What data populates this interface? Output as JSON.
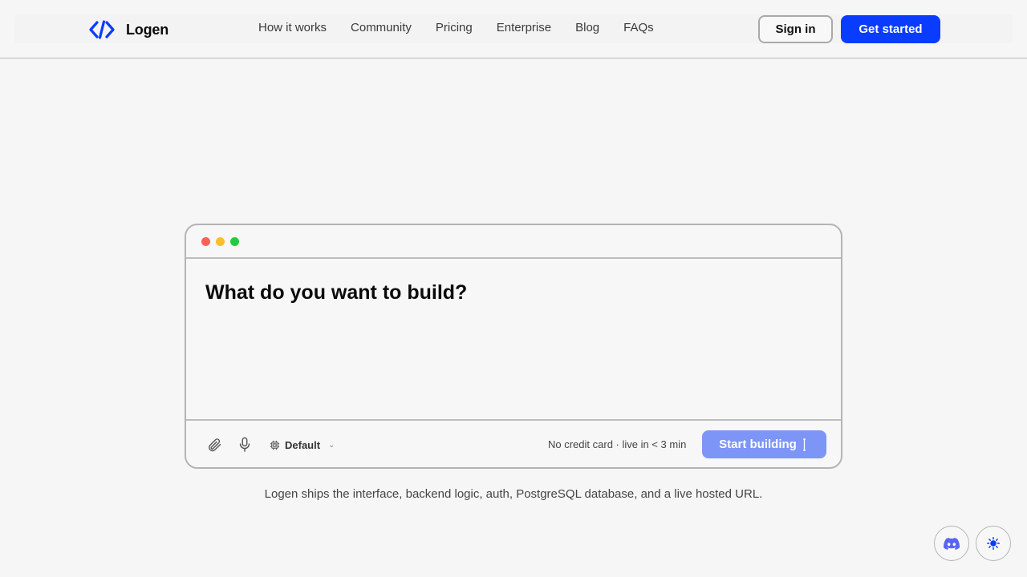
{
  "brand": {
    "name": "Logen"
  },
  "nav": {
    "items": [
      "How it works",
      "Community",
      "Pricing",
      "Enterprise",
      "Blog",
      "FAQs"
    ]
  },
  "header": {
    "sign_in_label": "Sign in",
    "get_started_label": "Get started"
  },
  "prompt": {
    "placeholder": "What do you want to build?",
    "model": "Default",
    "note": "No credit card · live in < 3 min",
    "start_label": "Start building"
  },
  "tagline": "Logen ships the interface, backend logic, auth, PostgreSQL database, and a live hosted URL.",
  "colors": {
    "accent": "#0a3cff",
    "start_button": "#7d95f7",
    "discord": "#5865f2"
  },
  "icons": {
    "logo": "code-brackets-icon",
    "attach": "paperclip-icon",
    "mic": "microphone-icon",
    "model": "cpu-chip-icon",
    "discord": "discord-icon",
    "theme": "sun-icon"
  }
}
